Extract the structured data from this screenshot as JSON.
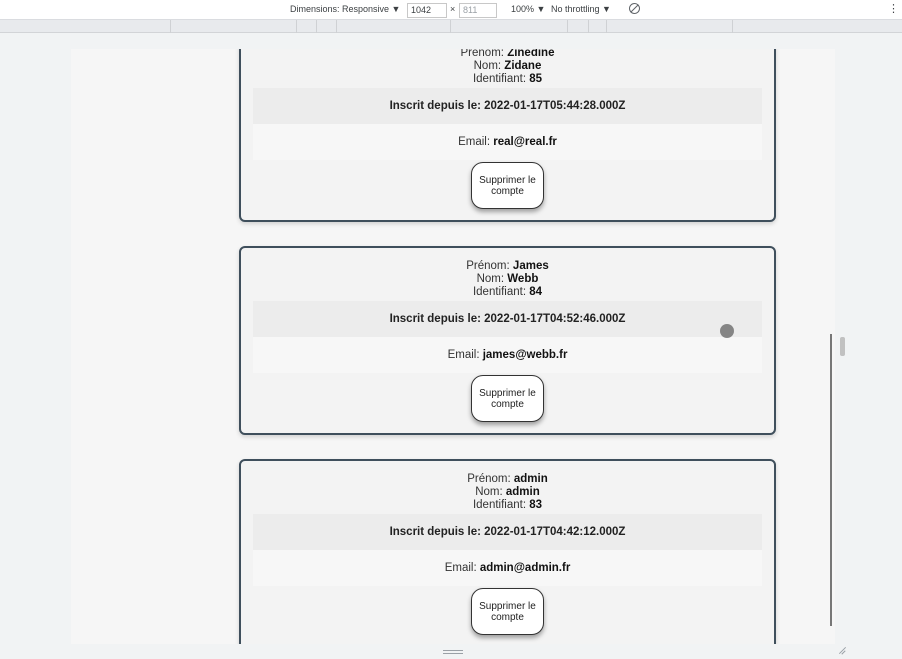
{
  "devtools": {
    "dimensions_label": "Dimensions: Responsive ▼",
    "width": "1042",
    "times": "×",
    "height": "811",
    "zoom": "100% ▼",
    "throttling": "No throttling ▼",
    "more": "⋮"
  },
  "users": [
    {
      "prenom_label": "Prénom: ",
      "prenom": "Zinedine",
      "nom_label": "Nom: ",
      "nom": "Zidane",
      "id_label": "Identifiant: ",
      "id": "85",
      "since": "Inscrit depuis le: 2022-01-17T05:44:28.000Z",
      "email_label": "Email: ",
      "email": "real@real.fr",
      "delete_label": "Supprimer le compte"
    },
    {
      "prenom_label": "Prénom: ",
      "prenom": "James",
      "nom_label": "Nom: ",
      "nom": "Webb",
      "id_label": "Identifiant: ",
      "id": "84",
      "since": "Inscrit depuis le: 2022-01-17T04:52:46.000Z",
      "email_label": "Email: ",
      "email": "james@webb.fr",
      "delete_label": "Supprimer le compte"
    },
    {
      "prenom_label": "Prénom: ",
      "prenom": "admin",
      "nom_label": "Nom: ",
      "nom": "admin",
      "id_label": "Identifiant: ",
      "id": "83",
      "since": "Inscrit depuis le: 2022-01-17T04:42:12.000Z",
      "email_label": "Email: ",
      "email": "admin@admin.fr",
      "delete_label": "Supprimer le compte"
    }
  ]
}
